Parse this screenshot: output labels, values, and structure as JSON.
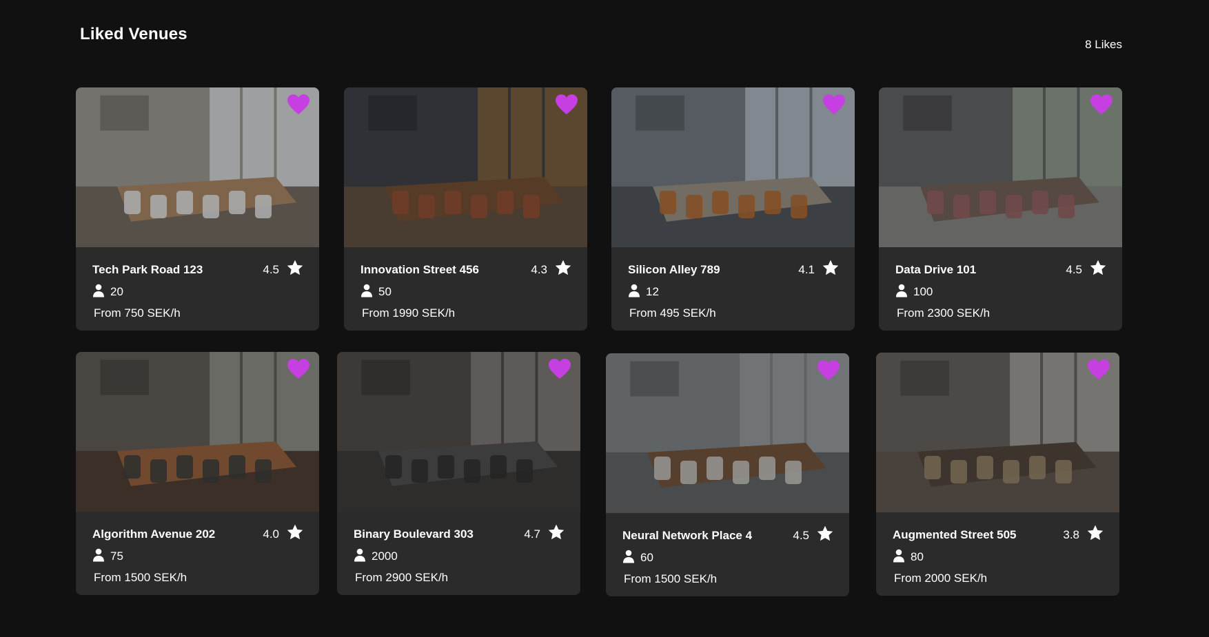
{
  "header": {
    "title": "Liked Venues",
    "likes": "8 Likes"
  },
  "colors": {
    "background": "#111111",
    "card": "#2b2b2b",
    "heart": "#c63fe0",
    "text": "#ffffff"
  },
  "icons": {
    "favorite": "heart-icon",
    "rating": "star-icon",
    "capacity": "person-icon"
  },
  "venues": [
    {
      "name": "Tech Park Road 123",
      "rating": "4.5",
      "capacity": "20",
      "price": "From 750 SEK/h",
      "photo": "meeting room with long wooden table and city view windows"
    },
    {
      "name": "Innovation Street 456",
      "rating": "4.3",
      "capacity": "50",
      "price": "From 1990 SEK/h",
      "photo": "dark office with wooden desk and leather chairs"
    },
    {
      "name": "Silicon Alley 789",
      "rating": "4.1",
      "capacity": "12",
      "price": "From 495 SEK/h",
      "photo": "bright conference room with oval table and orange chairs"
    },
    {
      "name": "Data Drive 101",
      "rating": "4.5",
      "capacity": "100",
      "price": "From 2300 SEK/h",
      "photo": "open loft with glass walls and pendant lights"
    },
    {
      "name": "Algorithm Avenue 202",
      "rating": "4.0",
      "capacity": "75",
      "price": "From 1500 SEK/h",
      "photo": "people in a meeting around a table with laptops"
    },
    {
      "name": "Binary Boulevard 303",
      "rating": "4.7",
      "capacity": "2000",
      "price": "From 2900 SEK/h",
      "photo": "studio with armchairs, lights and camera by windows"
    },
    {
      "name": "Neural Network Place 4",
      "rating": "4.5",
      "capacity": "60",
      "price": "From 1500 SEK/h",
      "photo": "white room with long table and white chairs"
    },
    {
      "name": "Augmented Street 505",
      "rating": "3.8",
      "capacity": "80",
      "price": "From 2000 SEK/h",
      "photo": "boardroom with long table and tan chairs by glass facade"
    }
  ]
}
